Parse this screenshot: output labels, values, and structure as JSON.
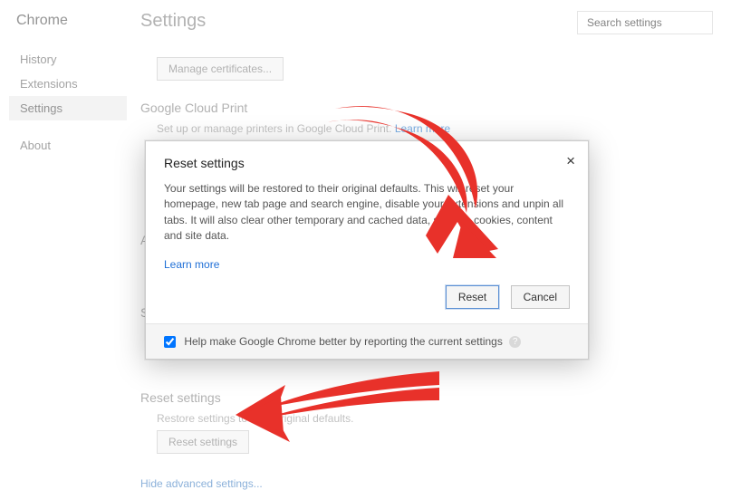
{
  "app": {
    "name": "Chrome"
  },
  "sidebar": {
    "items": [
      {
        "label": "History"
      },
      {
        "label": "Extensions"
      },
      {
        "label": "Settings"
      },
      {
        "label": "About"
      }
    ]
  },
  "page": {
    "title": "Settings",
    "search_placeholder": "Search settings"
  },
  "sections": {
    "certs": {
      "button": "Manage certificates..."
    },
    "cloud_print": {
      "title": "Google Cloud Print",
      "desc_prefix": "Set up or manage printers in Google Cloud Print. ",
      "learn": "Learn more"
    },
    "accessibility_initial": "A",
    "system_initial": "S",
    "reset": {
      "title": "Reset settings",
      "desc": "Restore settings to their original defaults.",
      "button": "Reset settings"
    },
    "hide_link": "Hide advanced settings..."
  },
  "modal": {
    "title": "Reset settings",
    "body": "Your settings will be restored to their original defaults. This will reset your homepage, new tab page and search engine, disable your extensions and unpin all tabs. It will also clear other temporary and cached data, such as cookies, content and site data.",
    "learn": "Learn more",
    "reset": "Reset",
    "cancel": "Cancel",
    "help_checkbox": "Help make Google Chrome better by reporting the current settings"
  }
}
